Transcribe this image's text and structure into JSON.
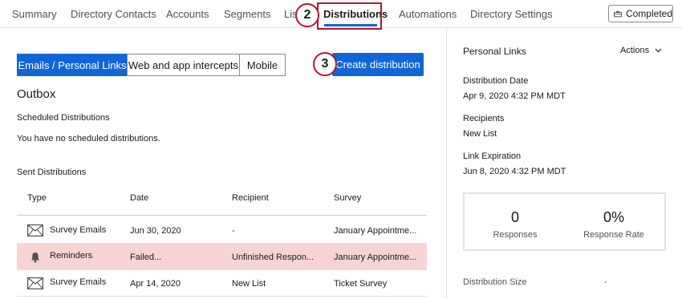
{
  "nav": {
    "items": [
      "Summary",
      "Directory Contacts",
      "Accounts",
      "Segments",
      "Lis",
      "Distributions",
      "Automations",
      "Directory Settings"
    ],
    "completed_label": "Completed"
  },
  "steps": {
    "two": "2",
    "three": "3"
  },
  "tabs": [
    "Emails / Personal Links",
    "Web and app intercepts",
    "Mobile"
  ],
  "create_label": "Create distribution",
  "outbox": {
    "title": "Outbox",
    "scheduled_heading": "Scheduled Distributions",
    "scheduled_empty": "You have no scheduled distributions.",
    "sent_heading": "Sent Distributions",
    "columns": [
      "Type",
      "Date",
      "Recipient",
      "Survey"
    ],
    "rows": [
      {
        "type": "Survey Emails",
        "icon": "envelope-icon",
        "date": "Jun 30, 2020",
        "recipient": "-",
        "survey": "January Appointme..."
      },
      {
        "type": "Reminders",
        "icon": "bell-icon",
        "date": "Failed...",
        "recipient": "Unfinished Respon...",
        "survey": "January Appointme..."
      },
      {
        "type": "Survey Emails",
        "icon": "envelope-icon",
        "date": "Apr 14, 2020",
        "recipient": "New List",
        "survey": "Ticket Survey"
      }
    ]
  },
  "panel": {
    "title": "Personal Links",
    "actions_label": "Actions",
    "date_label": "Distribution Date",
    "date_value": "Apr 9, 2020 4:32 PM MDT",
    "recipients_label": "Recipients",
    "recipients_value": "New List",
    "expiration_label": "Link Expiration",
    "expiration_value": "Jun 8, 2020 4:32 PM MDT",
    "responses_value": "0",
    "responses_label": "Responses",
    "rate_value": "0%",
    "rate_label": "Response Rate",
    "size_label": "Distribution Size",
    "size_value": "-"
  },
  "colors": {
    "accent": "#1066d6",
    "annotation": "#b01a2e",
    "failed_row": "#f7d4d4"
  }
}
